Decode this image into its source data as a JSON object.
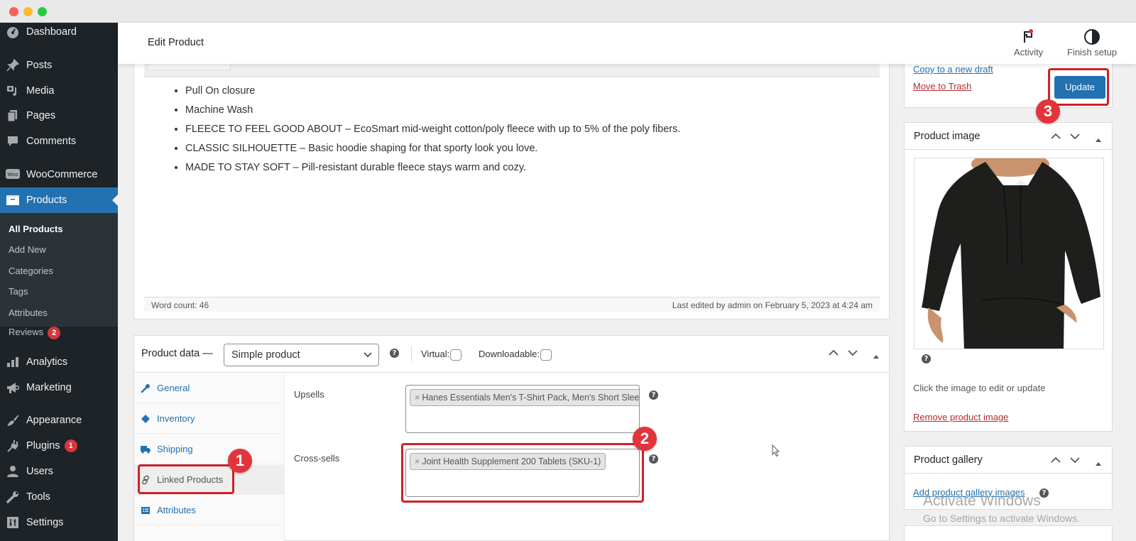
{
  "window": {
    "controls": [
      "close",
      "minimize",
      "maximize"
    ]
  },
  "sidebar": {
    "items": [
      {
        "label": "Dashboard",
        "icon": "dashboard-icon"
      },
      {
        "label": "Posts",
        "icon": "pin-icon"
      },
      {
        "label": "Media",
        "icon": "media-icon"
      },
      {
        "label": "Pages",
        "icon": "pages-icon"
      },
      {
        "label": "Comments",
        "icon": "comment-icon"
      },
      {
        "label": "WooCommerce",
        "icon": "woo-icon"
      },
      {
        "label": "Products",
        "icon": "archive-icon",
        "active": true
      },
      {
        "label": "Analytics",
        "icon": "bar-chart-icon"
      },
      {
        "label": "Marketing",
        "icon": "megaphone-icon"
      },
      {
        "label": "Appearance",
        "icon": "brush-icon"
      },
      {
        "label": "Plugins",
        "icon": "plug-icon",
        "badge": "1"
      },
      {
        "label": "Users",
        "icon": "user-icon"
      },
      {
        "label": "Tools",
        "icon": "wrench-icon"
      },
      {
        "label": "Settings",
        "icon": "sliders-icon"
      }
    ],
    "submenu": [
      {
        "label": "All Products",
        "current": true
      },
      {
        "label": "Add New"
      },
      {
        "label": "Categories"
      },
      {
        "label": "Tags"
      },
      {
        "label": "Attributes"
      },
      {
        "label": "Reviews",
        "badge": "2"
      }
    ]
  },
  "header": {
    "title": "Edit Product",
    "activity_label": "Activity",
    "finish_setup_label": "Finish setup"
  },
  "editor": {
    "bullets": [
      "Pull On closure",
      "Machine Wash",
      "FLEECE TO FEEL GOOD ABOUT – EcoSmart mid-weight cotton/poly fleece with up to 5% of the poly fibers.",
      "CLASSIC SILHOUETTE – Basic hoodie shaping for that sporty look you love.",
      "MADE TO STAY SOFT – Pill-resistant durable fleece stays warm and cozy."
    ],
    "word_count": "Word count: 46",
    "last_edited": "Last edited by admin on February 5, 2023 at 4:24 am"
  },
  "product_data": {
    "title": "Product data —",
    "type_selected": "Simple product",
    "virtual_label": "Virtual:",
    "downloadable_label": "Downloadable:",
    "virtual_checked": false,
    "downloadable_checked": false,
    "tabs": [
      {
        "label": "General",
        "icon": "wrench-icon"
      },
      {
        "label": "Inventory",
        "icon": "tag-icon"
      },
      {
        "label": "Shipping",
        "icon": "truck-icon"
      },
      {
        "label": "Linked Products",
        "icon": "link-icon",
        "active": true
      },
      {
        "label": "Attributes",
        "icon": "list-icon"
      }
    ],
    "upsells_label": "Upsells",
    "upsells_items": [
      "Hanes Essentials Men's T-Shirt Pack, Men's Short Sleeve"
    ],
    "crosssells_label": "Cross-sells",
    "crosssells_items": [
      "Joint Health Supplement 200 Tablets (SKU-1)"
    ],
    "chip_remove": "×"
  },
  "publish": {
    "copy_draft": "Copy to a new draft",
    "move_trash": "Move to Trash",
    "update_label": "Update"
  },
  "product_image": {
    "title": "Product image",
    "hint": "Click the image to edit or update",
    "remove_label": "Remove product image"
  },
  "product_gallery": {
    "title": "Product gallery",
    "add_label": "Add product gallery images"
  },
  "help_glyph": "?",
  "annotations": [
    "1",
    "2",
    "3"
  ],
  "watermark": {
    "title": "Activate Windows",
    "subtitle": "Go to Settings to activate Windows."
  },
  "colors": {
    "accent": "#2271b1",
    "sidebar_bg": "#1d2327",
    "annotation_red": "#d0202a",
    "danger_link": "#b32d2e"
  }
}
